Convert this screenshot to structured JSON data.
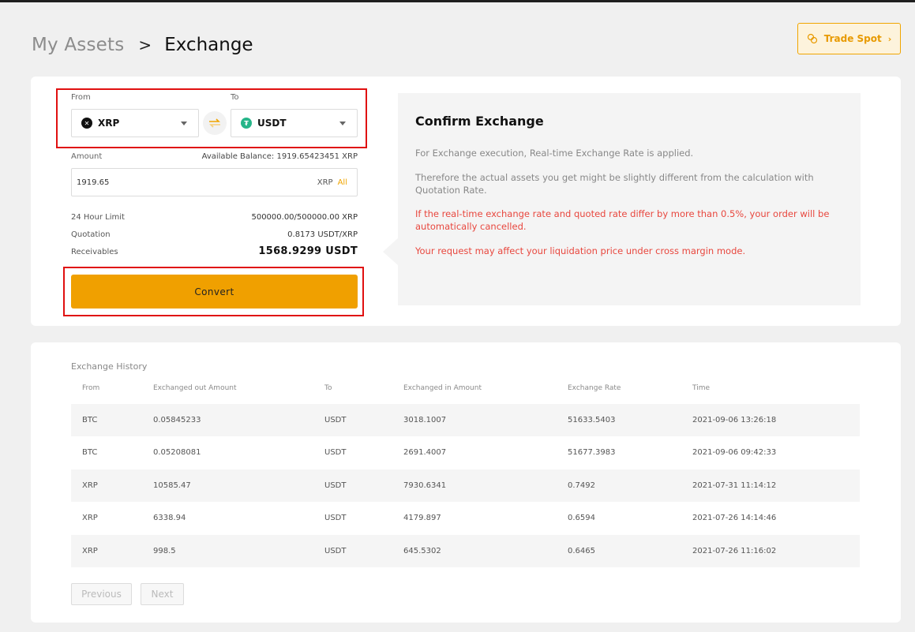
{
  "breadcrumb": {
    "root": "My Assets",
    "separator": ">",
    "current": "Exchange"
  },
  "trade_spot": {
    "label": "Trade Spot"
  },
  "exchange_form": {
    "from_label": "From",
    "to_label": "To",
    "from_coin": "XRP",
    "to_coin": "USDT",
    "amount_label": "Amount",
    "available_balance": "Available Balance: 1919.65423451 XRP",
    "amount_value": "1919.65",
    "amount_unit": "XRP",
    "all_label": "All",
    "limit_label": "24 Hour Limit",
    "limit_value": "500000.00/500000.00 XRP",
    "quotation_label": "Quotation",
    "quotation_value": "0.8173 USDT/XRP",
    "receivables_label": "Receivables",
    "receivables_value": "1568.9299 USDT",
    "convert_label": "Convert"
  },
  "confirm": {
    "title": "Confirm Exchange",
    "p1": "For Exchange execution, Real-time Exchange Rate is applied.",
    "p2": "Therefore the actual assets you get might be slightly different from the calculation with Quotation Rate.",
    "p3": "If the real-time exchange rate and quoted rate differ by more than 0.5%, your order will be automatically cancelled.",
    "p4": "Your request may affect your liquidation price under cross margin mode."
  },
  "history": {
    "title": "Exchange History",
    "columns": [
      "From",
      "Exchanged out Amount",
      "To",
      "Exchanged in Amount",
      "Exchange Rate",
      "Time"
    ],
    "rows": [
      [
        "BTC",
        "0.05845233",
        "USDT",
        "3018.1007",
        "51633.5403",
        "2021-09-06 13:26:18"
      ],
      [
        "BTC",
        "0.05208081",
        "USDT",
        "2691.4007",
        "51677.3983",
        "2021-09-06 09:42:33"
      ],
      [
        "XRP",
        "10585.47",
        "USDT",
        "7930.6341",
        "0.7492",
        "2021-07-31 11:14:12"
      ],
      [
        "XRP",
        "6338.94",
        "USDT",
        "4179.897",
        "0.6594",
        "2021-07-26 14:14:46"
      ],
      [
        "XRP",
        "998.5",
        "USDT",
        "645.5302",
        "0.6465",
        "2021-07-26 11:16:02"
      ]
    ],
    "prev_label": "Previous",
    "next_label": "Next"
  },
  "colors": {
    "accent": "#f0a000",
    "highlight": "#e01010",
    "warning": "#e8473e",
    "usdt": "#26b589",
    "xrp": "#111111"
  },
  "icons": {
    "from_coin": "xrp-icon",
    "to_coin": "usdt-icon",
    "swap": "swap-arrows-icon",
    "trade_spot": "cycle-icon"
  }
}
